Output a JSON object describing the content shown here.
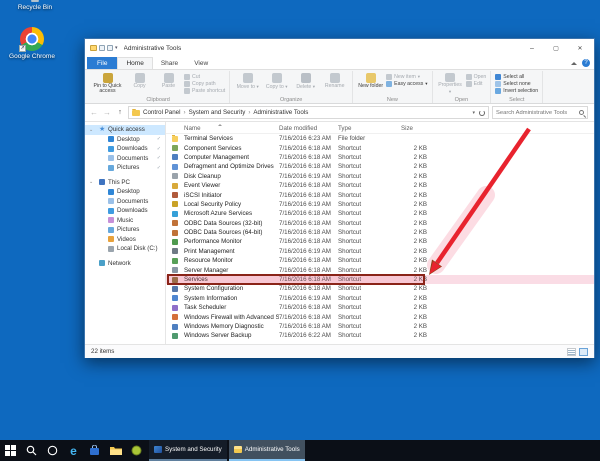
{
  "desktop": {
    "icons": [
      {
        "label": "Recycle Bin",
        "icon": "recycle-bin-icon"
      },
      {
        "label": "Google Chrome",
        "icon": "chrome-icon"
      }
    ],
    "background_color": "#0e69bf"
  },
  "window": {
    "title": "Administrative Tools",
    "tabs": [
      {
        "label": "File",
        "kind": "file"
      },
      {
        "label": "Home",
        "kind": "active"
      },
      {
        "label": "Share",
        "kind": "plain"
      },
      {
        "label": "View",
        "kind": "plain"
      }
    ],
    "ribbon": {
      "groups": [
        {
          "name": "Clipboard",
          "big": [
            {
              "label": "Pin to Quick access",
              "icon": "pin-icon",
              "color": "#caa53c",
              "wide": true
            },
            {
              "label": "Copy",
              "icon": "copy-icon",
              "color": "#c3c9cf",
              "disabled": true
            },
            {
              "label": "Paste",
              "icon": "paste-icon",
              "color": "#c3c9cf",
              "disabled": true
            }
          ],
          "small": [
            {
              "label": "Cut",
              "icon": "cut-icon",
              "color": "#c3c9cf",
              "disabled": true
            },
            {
              "label": "Copy path",
              "icon": "copy-path-icon",
              "color": "#c3c9cf",
              "disabled": true
            },
            {
              "label": "Paste shortcut",
              "icon": "paste-shortcut-icon",
              "color": "#c3c9cf",
              "disabled": true
            }
          ]
        },
        {
          "name": "Organize",
          "big": [
            {
              "label": "Move to",
              "icon": "move-to-icon",
              "color": "#c3c9cf",
              "disabled": true,
              "menu": true
            },
            {
              "label": "Copy to",
              "icon": "copy-to-icon",
              "color": "#c3c9cf",
              "disabled": true,
              "menu": true
            },
            {
              "label": "Delete",
              "icon": "delete-icon",
              "color": "#b9bfc6",
              "disabled": true,
              "menu": true
            },
            {
              "label": "Rename",
              "icon": "rename-icon",
              "color": "#c3c9cf",
              "disabled": true
            }
          ],
          "small": []
        },
        {
          "name": "New",
          "big": [
            {
              "label": "New folder",
              "icon": "new-folder-icon",
              "color": "#e8c86a"
            }
          ],
          "small": [
            {
              "label": "New item",
              "icon": "new-item-icon",
              "color": "#c3c9cf",
              "disabled": true,
              "menu": true
            },
            {
              "label": "Easy access",
              "icon": "easy-access-icon",
              "color": "#7fb2e0",
              "menu": true
            }
          ]
        },
        {
          "name": "Open",
          "big": [
            {
              "label": "Properties",
              "icon": "properties-icon",
              "color": "#c3c9cf",
              "disabled": true,
              "menu": true
            }
          ],
          "small": [
            {
              "label": "Open",
              "icon": "open-icon",
              "color": "#c3c9cf",
              "disabled": true
            },
            {
              "label": "Edit",
              "icon": "edit-icon",
              "color": "#c3c9cf",
              "disabled": true
            }
          ]
        },
        {
          "name": "Select",
          "big": [],
          "small": [
            {
              "label": "Select all",
              "icon": "select-all-icon",
              "color": "#3f86d4"
            },
            {
              "label": "Select none",
              "icon": "select-none-icon",
              "color": "#9fc4e8"
            },
            {
              "label": "Invert selection",
              "icon": "invert-selection-icon",
              "color": "#6aa8e0"
            }
          ]
        }
      ]
    },
    "address": {
      "breadcrumb": [
        "Control Panel",
        "System and Security",
        "Administrative Tools"
      ],
      "search_placeholder": "Search Administrative Tools"
    },
    "sidebar": [
      {
        "label": "Quick access",
        "icon": "quick-access-star-icon",
        "level": 0,
        "selected": true,
        "chevron": true
      },
      {
        "label": "Desktop",
        "icon": "desktop-icon",
        "level": 1,
        "pinned": true,
        "color": "#2f86d6"
      },
      {
        "label": "Downloads",
        "icon": "downloads-icon",
        "level": 1,
        "pinned": true,
        "color": "#3f9be0"
      },
      {
        "label": "Documents",
        "icon": "documents-icon",
        "level": 1,
        "pinned": true,
        "color": "#9ac0e8"
      },
      {
        "label": "Pictures",
        "icon": "pictures-icon",
        "level": 1,
        "pinned": true,
        "color": "#66a8dc"
      },
      {
        "label": "This PC",
        "icon": "computer-icon",
        "level": 0,
        "gap": true,
        "chevron": true,
        "color": "#3f74c0"
      },
      {
        "label": "Desktop",
        "icon": "desktop-icon",
        "level": 1,
        "color": "#2f86d6"
      },
      {
        "label": "Documents",
        "icon": "documents-icon",
        "level": 1,
        "color": "#9ac0e8"
      },
      {
        "label": "Downloads",
        "icon": "downloads-icon",
        "level": 1,
        "color": "#3f9be0"
      },
      {
        "label": "Music",
        "icon": "music-icon",
        "level": 1,
        "color": "#c690d8"
      },
      {
        "label": "Pictures",
        "icon": "pictures-icon",
        "level": 1,
        "color": "#66a8dc"
      },
      {
        "label": "Videos",
        "icon": "videos-icon",
        "level": 1,
        "color": "#e8a23c"
      },
      {
        "label": "Local Disk (C:)",
        "icon": "local-disk-icon",
        "level": 1,
        "color": "#9aa4ad"
      },
      {
        "label": "Network",
        "icon": "network-icon",
        "level": 0,
        "gap": true,
        "color": "#4aa0c8"
      }
    ],
    "columns": [
      "Name",
      "Date modified",
      "Type",
      "Size"
    ],
    "files": [
      {
        "name": "Terminal Services",
        "date": "7/16/2016 6:23 AM",
        "type": "File folder",
        "size": "",
        "icon": "folder-icon",
        "color": "#f7cf5e"
      },
      {
        "name": "Component Services",
        "date": "7/16/2016 6:18 AM",
        "type": "Shortcut",
        "size": "2 KB",
        "icon": "component-services-icon",
        "color": "#7da65a"
      },
      {
        "name": "Computer Management",
        "date": "7/16/2016 6:18 AM",
        "type": "Shortcut",
        "size": "2 KB",
        "icon": "computer-management-icon",
        "color": "#4e7fc0"
      },
      {
        "name": "Defragment and Optimize Drives",
        "date": "7/16/2016 6:18 AM",
        "type": "Shortcut",
        "size": "2 KB",
        "icon": "defragment-icon",
        "color": "#5f92d6"
      },
      {
        "name": "Disk Cleanup",
        "date": "7/16/2016 6:19 AM",
        "type": "Shortcut",
        "size": "2 KB",
        "icon": "disk-cleanup-icon",
        "color": "#9aa3ab"
      },
      {
        "name": "Event Viewer",
        "date": "7/16/2016 6:18 AM",
        "type": "Shortcut",
        "size": "2 KB",
        "icon": "event-viewer-icon",
        "color": "#d8a93a"
      },
      {
        "name": "iSCSI Initiator",
        "date": "7/16/2016 6:18 AM",
        "type": "Shortcut",
        "size": "2 KB",
        "icon": "iscsi-initiator-icon",
        "color": "#b05a3c"
      },
      {
        "name": "Local Security Policy",
        "date": "7/16/2016 6:19 AM",
        "type": "Shortcut",
        "size": "2 KB",
        "icon": "local-security-policy-icon",
        "color": "#c9a227"
      },
      {
        "name": "Microsoft Azure Services",
        "date": "7/16/2016 6:18 AM",
        "type": "Shortcut",
        "size": "2 KB",
        "icon": "azure-services-icon",
        "color": "#35a0d8"
      },
      {
        "name": "ODBC Data Sources (32-bit)",
        "date": "7/16/2016 6:18 AM",
        "type": "Shortcut",
        "size": "2 KB",
        "icon": "odbc-32-icon",
        "color": "#c07238"
      },
      {
        "name": "ODBC Data Sources (64-bit)",
        "date": "7/16/2016 6:18 AM",
        "type": "Shortcut",
        "size": "2 KB",
        "icon": "odbc-64-icon",
        "color": "#c07238"
      },
      {
        "name": "Performance Monitor",
        "date": "7/16/2016 6:18 AM",
        "type": "Shortcut",
        "size": "2 KB",
        "icon": "performance-monitor-icon",
        "color": "#4f9a4f"
      },
      {
        "name": "Print Management",
        "date": "7/16/2016 6:19 AM",
        "type": "Shortcut",
        "size": "2 KB",
        "icon": "print-management-icon",
        "color": "#6f7a85"
      },
      {
        "name": "Resource Monitor",
        "date": "7/16/2016 6:18 AM",
        "type": "Shortcut",
        "size": "2 KB",
        "icon": "resource-monitor-icon",
        "color": "#58a058"
      },
      {
        "name": "Server Manager",
        "date": "7/16/2016 6:18 AM",
        "type": "Shortcut",
        "size": "2 KB",
        "icon": "server-manager-icon",
        "color": "#8a97a5"
      },
      {
        "name": "Services",
        "date": "7/16/2016 6:18 AM",
        "type": "Shortcut",
        "size": "2 KB",
        "icon": "services-gears-icon",
        "color": "#8a6d3b",
        "highlighted": true
      },
      {
        "name": "System Configuration",
        "date": "7/16/2016 6:18 AM",
        "type": "Shortcut",
        "size": "2 KB",
        "icon": "system-configuration-icon",
        "color": "#5577aa"
      },
      {
        "name": "System Information",
        "date": "7/16/2016 6:19 AM",
        "type": "Shortcut",
        "size": "2 KB",
        "icon": "system-information-icon",
        "color": "#4f86d0"
      },
      {
        "name": "Task Scheduler",
        "date": "7/16/2016 6:18 AM",
        "type": "Shortcut",
        "size": "2 KB",
        "icon": "task-scheduler-icon",
        "color": "#8f6fc9"
      },
      {
        "name": "Windows Firewall with Advanced Security",
        "date": "7/16/2016 6:18 AM",
        "type": "Shortcut",
        "size": "2 KB",
        "icon": "firewall-icon",
        "color": "#d4703a"
      },
      {
        "name": "Windows Memory Diagnostic",
        "date": "7/16/2016 6:18 AM",
        "type": "Shortcut",
        "size": "2 KB",
        "icon": "memory-diagnostic-icon",
        "color": "#4e7fc0"
      },
      {
        "name": "Windows Server Backup",
        "date": "7/16/2016 6:22 AM",
        "type": "Shortcut",
        "size": "2 KB",
        "icon": "server-backup-icon",
        "color": "#4f9a6f"
      }
    ],
    "status": "22 items"
  },
  "annotation": {
    "arrow_color": "#e8232e",
    "highlight_box_color": "#8a2418",
    "points_to": "Services"
  },
  "taskbar": {
    "buttons": [
      {
        "label": "System and Security",
        "icon": "control-panel-icon",
        "active": false
      },
      {
        "label": "Administrative Tools",
        "icon": "folder-window-icon",
        "active": true
      }
    ]
  }
}
